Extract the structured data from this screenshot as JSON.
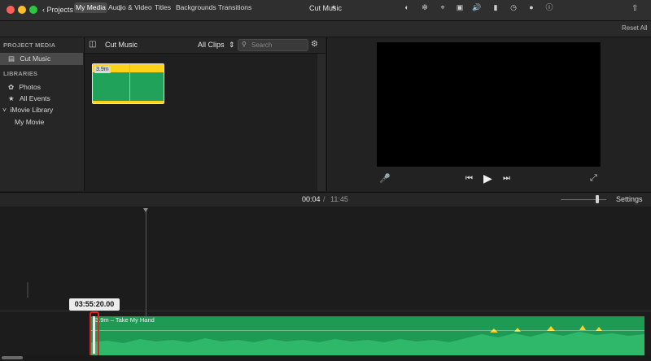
{
  "window": {
    "title": "Cut Music",
    "back_label": "Projects"
  },
  "toolbar": {
    "tabs": [
      "My Media",
      "Audio & Video",
      "Titles",
      "Backgrounds",
      "Transitions"
    ],
    "active_tab": "My Media",
    "reset_all": "Reset All",
    "viewer_tools": [
      "magic-wand-icon",
      "color-balance-icon",
      "color-correction-icon",
      "crop-icon",
      "stabilization-icon",
      "volume-icon",
      "equalizer-icon",
      "speed-icon",
      "filter-icon",
      "info-icon"
    ]
  },
  "sidebar": {
    "project_media_header": "PROJECT MEDIA",
    "project_item": "Cut Music",
    "libraries_header": "LIBRARIES",
    "library_items": [
      "Photos",
      "All Events"
    ],
    "library_name": "iMovie Library",
    "library_child": "My Movie"
  },
  "browser": {
    "title": "Cut Music",
    "filter": "All Clips",
    "search_placeholder": "Search",
    "clip_duration": "3.9m"
  },
  "timeline": {
    "current_time": "00:04",
    "separator": "/",
    "total_time": "11:45",
    "settings_label": "Settings",
    "tooltip_time": "03:55:20.00",
    "audio_clip_label": "3.9m – Take My Hand",
    "zoom_level": 0.8
  },
  "colors": {
    "accent_green": "#21a25a",
    "waveform_yellow": "#ffd21a",
    "highlight_red": "#e02424"
  }
}
